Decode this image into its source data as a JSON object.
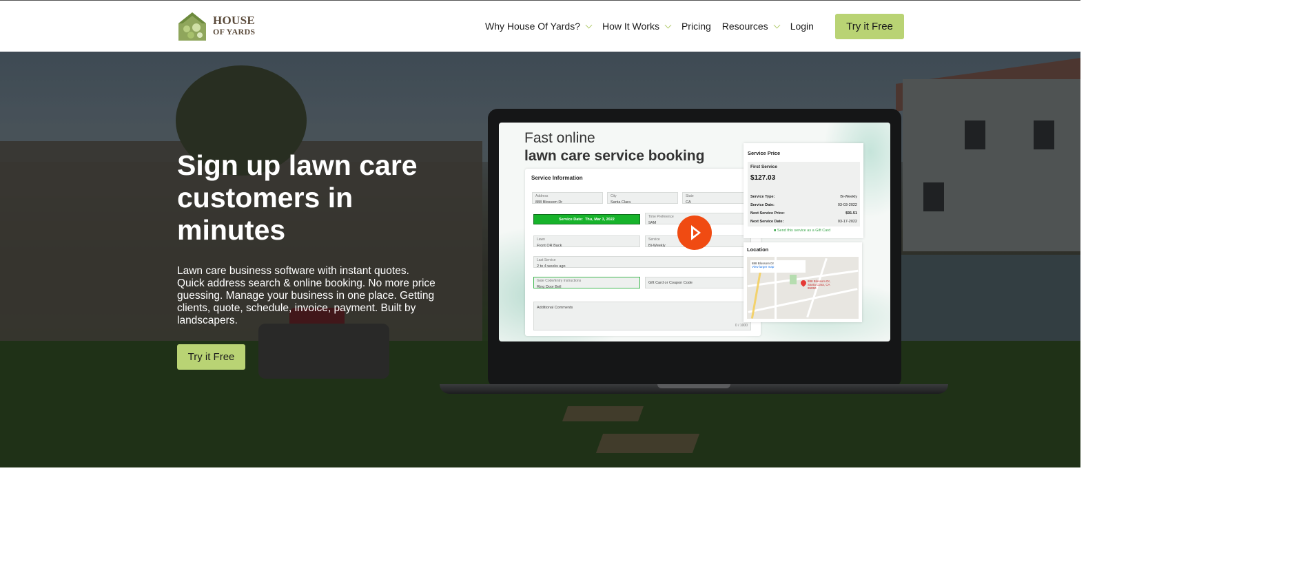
{
  "header": {
    "logo_line1": "HOUSE",
    "logo_line2": "OF YARDS",
    "nav": [
      {
        "label": "Why House Of Yards?",
        "has_dropdown": true
      },
      {
        "label": "How It Works",
        "has_dropdown": true
      },
      {
        "label": "Pricing",
        "has_dropdown": false
      },
      {
        "label": "Resources",
        "has_dropdown": true
      },
      {
        "label": "Login",
        "has_dropdown": false
      }
    ],
    "cta_label": "Try it Free"
  },
  "hero": {
    "title": "Sign up lawn care customers in minutes",
    "description": "Lawn care business software with instant quotes. Quick address search & online booking. No more price guessing. Manage your business in one place. Getting clients, quote, schedule, invoice, payment. Built by landscapers.",
    "cta_label": "Try it Free"
  },
  "video_preview": {
    "heading_line1": "Fast online",
    "heading_line2": "lawn care service booking",
    "form": {
      "title": "Service Information",
      "fields": {
        "address_label": "Address",
        "address_value": "888 Blossom Dr",
        "city_label": "City",
        "city_value": "Santa Clara",
        "state_label": "State",
        "state_value": "CA",
        "date_label": "Service Date:",
        "date_value": "Thu, Mar 3, 2022",
        "time_label": "Time Preference",
        "time_value": "9AM",
        "lawn_label": "Lawn",
        "lawn_value": "Front OR Back",
        "service_label": "Service",
        "service_value": "Bi-Weekly",
        "last_label": "Last Service",
        "last_value": "2 to 4 weeks ago",
        "instructions_label": "Gate Code/Entry Instructions",
        "instructions_value": "Ring Door Bell",
        "coupon_placeholder": "Gift Card or Coupon Code",
        "comments_placeholder": "Additional Comments",
        "comments_count": "0 / 1000"
      }
    },
    "price_card": {
      "title": "Service Price",
      "first_label": "First Service",
      "amount": "$127.03",
      "rows": [
        {
          "label": "Service Type:",
          "value": "Bi-Weekly"
        },
        {
          "label": "Service Date:",
          "value": "03-03-2022"
        },
        {
          "label": "Next Service Price:",
          "value": "$91.51"
        },
        {
          "label": "Next Service Date:",
          "value": "03-17-2022"
        }
      ],
      "gift_text": "Send this service as a Gift Card"
    },
    "location_card": {
      "title": "Location",
      "map_address": "888 Blossom Dr",
      "map_link": "View larger map",
      "pin_label": "888 Blossom Dr, Santa Clara, CA 95050"
    }
  }
}
